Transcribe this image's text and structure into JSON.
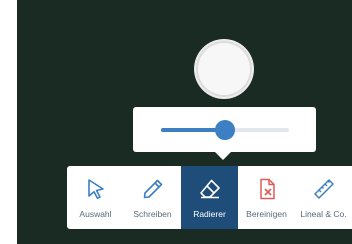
{
  "eraser": {
    "size_level": 0.5
  },
  "toolbar": {
    "tools": [
      {
        "label": "Auswahl",
        "icon": "select-arrow-icon",
        "active": false
      },
      {
        "label": "Schreiben",
        "icon": "pen-icon",
        "active": false
      },
      {
        "label": "Radierer",
        "icon": "eraser-icon",
        "active": true
      },
      {
        "label": "Bereinigen",
        "icon": "clear-page-icon",
        "active": false
      },
      {
        "label": "Lineal & Co.",
        "icon": "ruler-icon",
        "active": false
      }
    ]
  },
  "colors": {
    "board_background": "#1a2b23",
    "accent": "#3c7fc2",
    "active_tool_background": "#1e4d7a",
    "clear_icon": "#e15a5a",
    "tool_icon": "#3c7fc2"
  }
}
